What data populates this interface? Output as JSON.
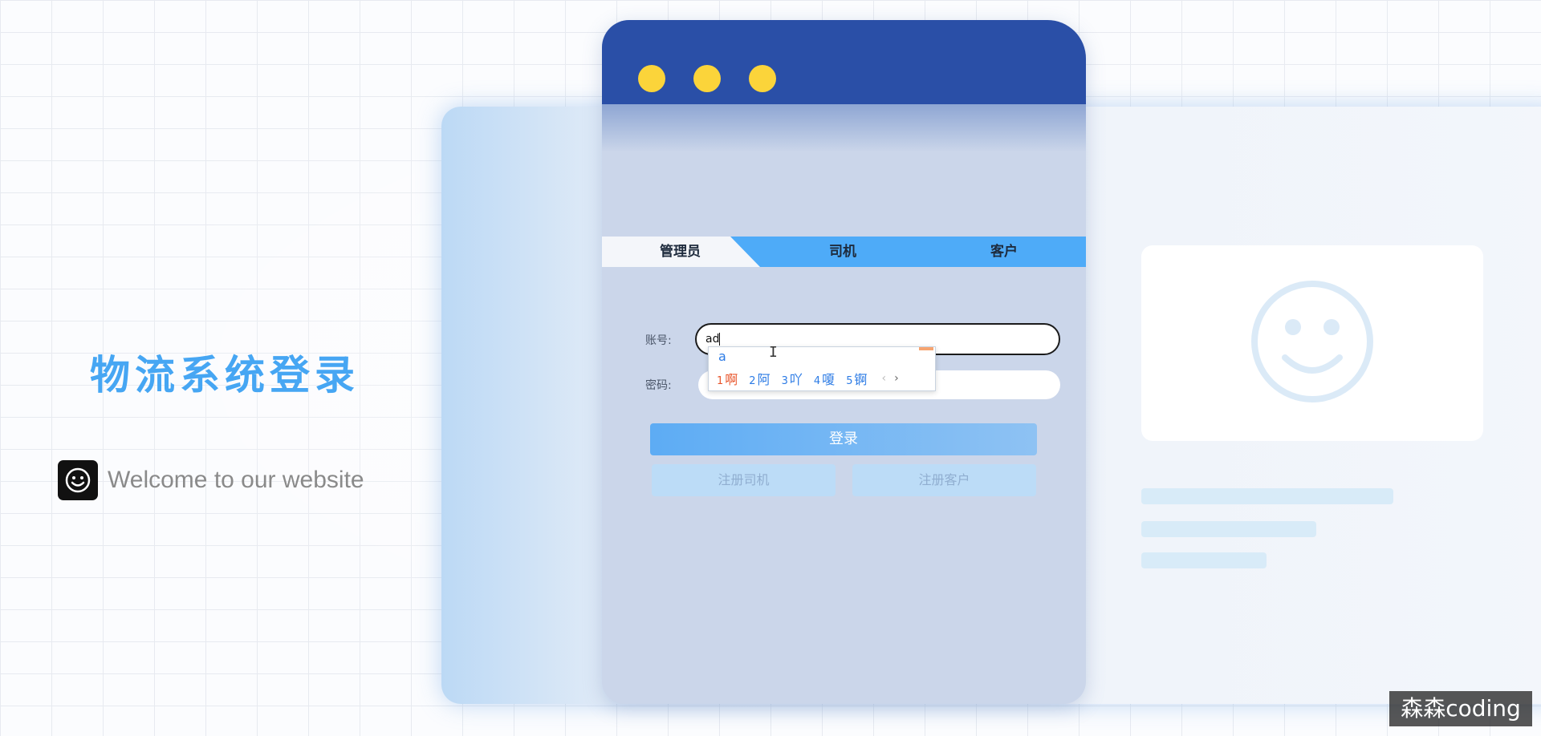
{
  "hero": {
    "title": "物流系统登录",
    "welcome": "Welcome to our website",
    "badge_icon": "smiley-icon"
  },
  "login": {
    "tabs": [
      {
        "label": "管理员",
        "active": true
      },
      {
        "label": "司机",
        "active": false
      },
      {
        "label": "客户",
        "active": false
      }
    ],
    "account_label": "账号:",
    "account_value": "ad",
    "password_label": "密码:",
    "login_button": "登录",
    "register_driver_button": "注册司机",
    "register_customer_button": "注册客户"
  },
  "ime": {
    "composition": "a",
    "candidates": [
      {
        "n": "1",
        "text": "啊"
      },
      {
        "n": "2",
        "text": "阿"
      },
      {
        "n": "3",
        "text": "吖"
      },
      {
        "n": "4",
        "text": "嗄"
      },
      {
        "n": "5",
        "text": "锕"
      }
    ],
    "prev": "‹",
    "next": "›"
  },
  "watermark": "森森coding",
  "colors": {
    "accent": "#46a6f3",
    "titlebar": "#2a4fa7",
    "window_dots": "#fbd43a",
    "tab_bar": "#4eabf8"
  }
}
